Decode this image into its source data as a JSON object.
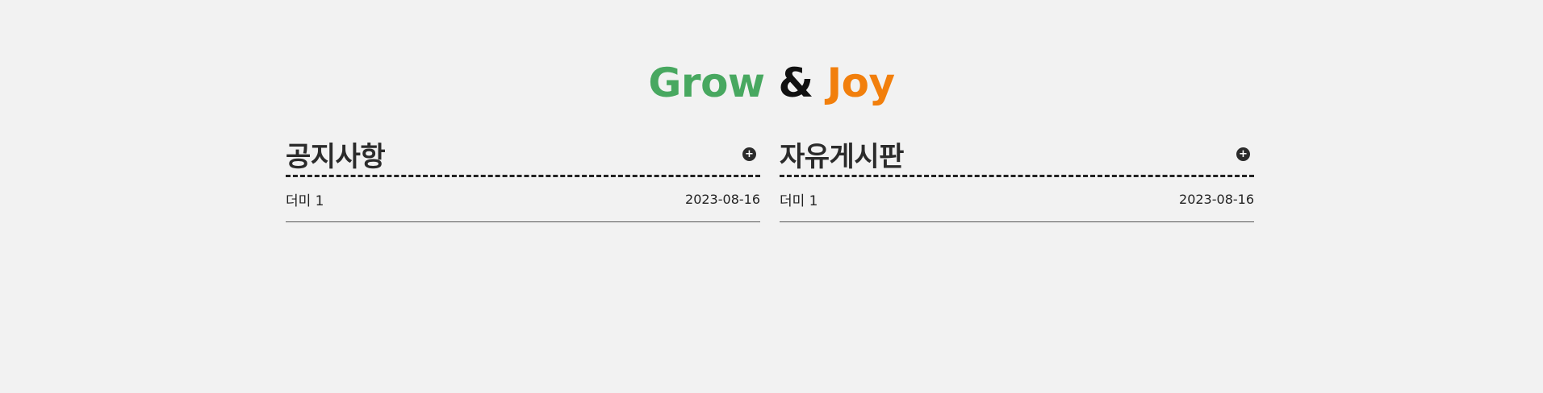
{
  "logo": {
    "part1": "Grow",
    "part2": "&",
    "part3": "Joy",
    "colors": {
      "part1": "#48a860",
      "part2": "#111111",
      "part3": "#f27f0c"
    }
  },
  "boards": [
    {
      "title": "공지사항",
      "more_icon": "plus-circle-icon",
      "posts": [
        {
          "title": "더미 1",
          "date": "2023-08-16"
        }
      ]
    },
    {
      "title": "자유게시판",
      "more_icon": "plus-circle-icon",
      "posts": [
        {
          "title": "더미 1",
          "date": "2023-08-16"
        }
      ]
    }
  ]
}
